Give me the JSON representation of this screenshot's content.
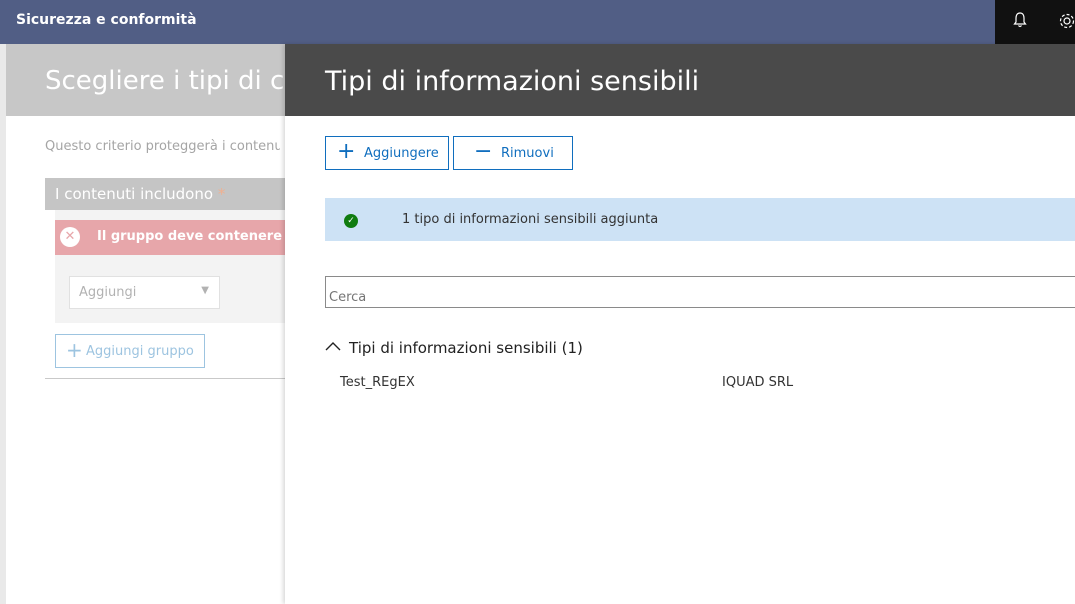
{
  "topbar": {
    "app_title": "Sicurezza e conformità",
    "icons": [
      "bell-icon",
      "gear-icon"
    ]
  },
  "background_page": {
    "title": "Scegliere i tipi di co",
    "description": "Questo criterio proteggerà i contenuti",
    "content_includes_label": "I contenuti includono",
    "required_marker": "*",
    "error_message": "Il gruppo deve contenere alm",
    "add_dropdown_placeholder": "Aggiungi",
    "add_group_label": "Aggiungi gruppo"
  },
  "panel": {
    "title": "Tipi di informazioni sensibili",
    "add_button_label": "Aggiungere",
    "remove_button_label": "Rimuovi",
    "notice_message": "1 tipo di informazioni sensibili aggiunta",
    "search_placeholder": "Cerca",
    "group_label": "Tipi di informazioni sensibili (1)",
    "rows": [
      {
        "name": "Test_REgEX",
        "publisher": "IQUAD SRL"
      }
    ]
  },
  "colors": {
    "topbar": "#515e85",
    "panel_header": "#4a4a4a",
    "accent": "#106ebe",
    "notice_bg": "#cde2f5",
    "success": "#107c10",
    "error_bg": "#e7a6aa"
  }
}
